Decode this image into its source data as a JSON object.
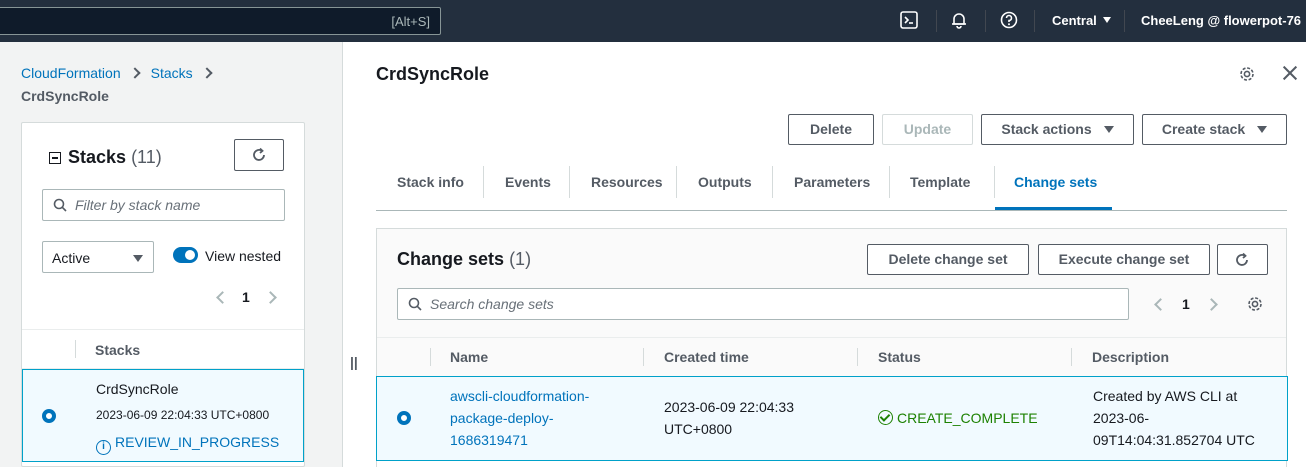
{
  "topnav": {
    "search_shortcut": "[Alt+S]",
    "icons": [
      "cloudshell-icon",
      "bell-icon",
      "help-icon"
    ],
    "region": "Central",
    "account": "CheeLeng @ flowerpot-76"
  },
  "breadcrumb": {
    "items": [
      "CloudFormation",
      "Stacks"
    ],
    "current": "CrdSyncRole"
  },
  "stacks_panel": {
    "title": "Stacks",
    "count": "(11)",
    "filter_placeholder": "Filter by stack name",
    "status_filter": "Active",
    "view_nested_label": "View nested",
    "view_nested_on": true,
    "page": "1",
    "column_header": "Stacks",
    "rows": [
      {
        "name": "CrdSyncRole",
        "date": "2023-06-09 22:04:33 UTC+0800",
        "status": "REVIEW_IN_PROGRESS",
        "selected": true
      }
    ]
  },
  "main": {
    "title": "CrdSyncRole",
    "actions": {
      "delete": "Delete",
      "update": "Update",
      "stack_actions": "Stack actions",
      "create_stack": "Create stack"
    },
    "tabs": [
      "Stack info",
      "Events",
      "Resources",
      "Outputs",
      "Parameters",
      "Template",
      "Change sets"
    ],
    "active_tab": "Change sets"
  },
  "change_sets": {
    "title": "Change sets",
    "count": "(1)",
    "delete_button": "Delete change set",
    "execute_button": "Execute change set",
    "search_placeholder": "Search change sets",
    "page": "1",
    "columns": [
      "Name",
      "Created time",
      "Status",
      "Description"
    ],
    "rows": [
      {
        "name_line1": "awscli-cloudformation-",
        "name_line2": "package-deploy-",
        "name_line3": "1686319471",
        "created_line1": "2023-06-09 22:04:33",
        "created_line2": "UTC+0800",
        "status": "CREATE_COMPLETE",
        "desc_line1": "Created by AWS CLI at",
        "desc_line2": "2023-06-",
        "desc_line3": "09T14:04:31.852704 UTC",
        "selected": true
      }
    ]
  },
  "colors": {
    "nav_bg": "#232f3e",
    "link": "#0073bb",
    "success": "#1d8102",
    "selected_row": "#f1faff"
  }
}
